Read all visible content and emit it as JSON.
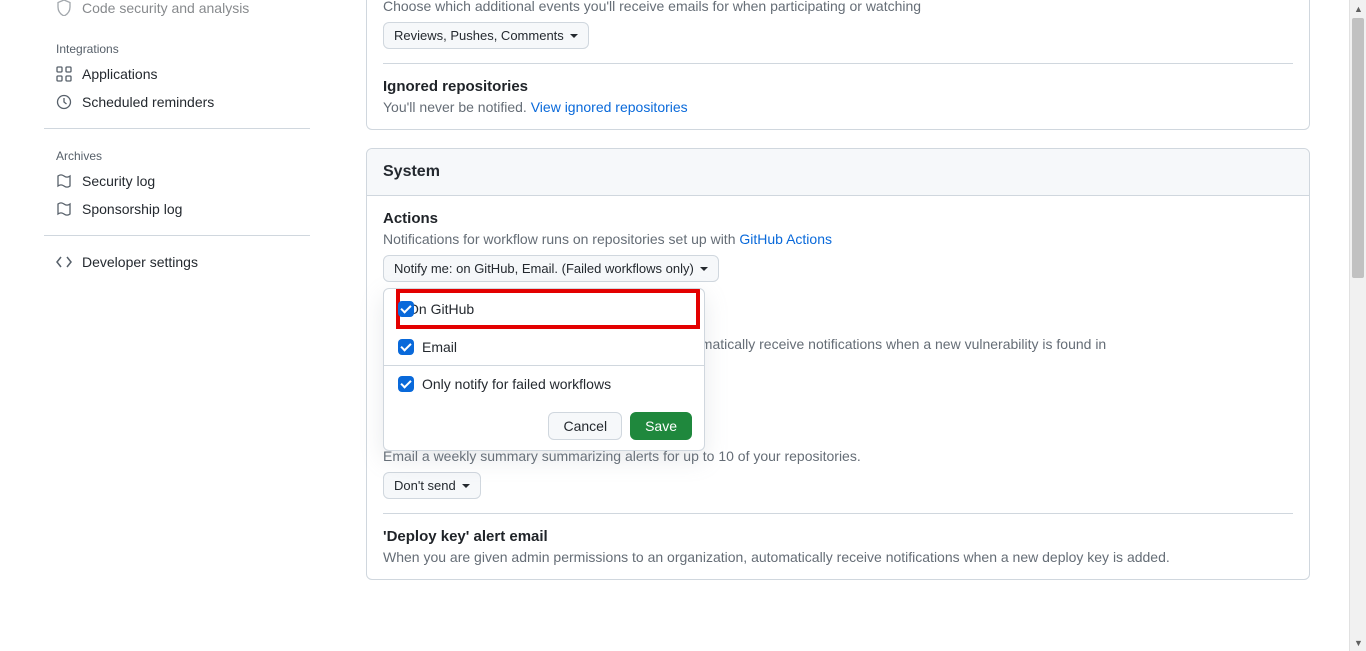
{
  "sidebar": {
    "item_partial": "Code security and analysis",
    "group_integrations": "Integrations",
    "applications": "Applications",
    "scheduled": "Scheduled reminders",
    "group_archives": "Archives",
    "security_log": "Security log",
    "sponsorship_log": "Sponsorship log",
    "developer": "Developer settings"
  },
  "email_updates": {
    "desc": "Choose which additional events you'll receive emails for when participating or watching",
    "dropdown": "Reviews, Pushes, Comments"
  },
  "ignored": {
    "title": "Ignored repositories",
    "desc": "You'll never be notified. ",
    "link": "View ignored repositories"
  },
  "system": {
    "header": "System"
  },
  "actions": {
    "title": "Actions",
    "desc_prefix": "Notifications for workflow runs on repositories set up with ",
    "desc_link": "GitHub Actions",
    "dropdown": "Notify me: on GitHub, Email. (Failed workflows only)"
  },
  "popover": {
    "on_github": "On GitHub",
    "email": "Email",
    "failed_only": "Only notify for failed workflows",
    "cancel": "Cancel",
    "save": "Save"
  },
  "hidden_vuln": {
    "desc_fragment": "omatically receive notifications when a new vulnerability is found in"
  },
  "weekly": {
    "desc": "Email a weekly summary summarizing alerts for up to 10 of your repositories.",
    "dropdown": "Don't send"
  },
  "deploy": {
    "title": "'Deploy key' alert email",
    "desc": "When you are given admin permissions to an organization, automatically receive notifications when a new deploy key is added."
  }
}
